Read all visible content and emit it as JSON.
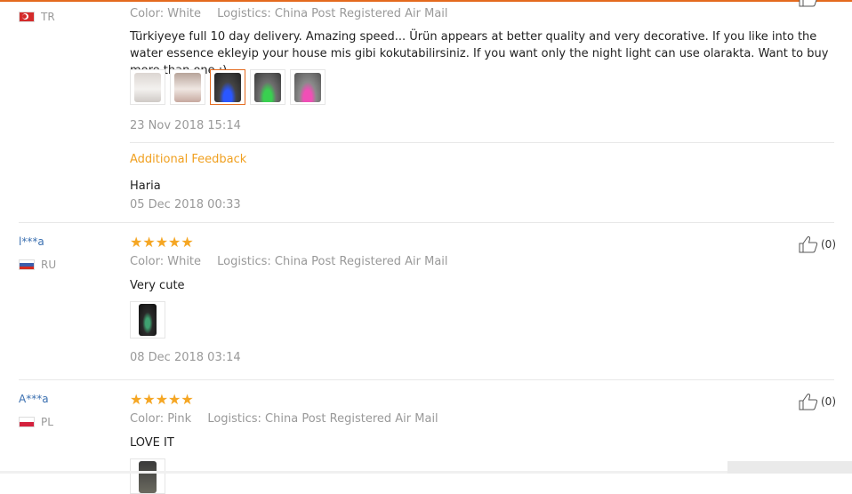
{
  "reviews": [
    {
      "user": "",
      "country": "TR",
      "color": "Color: White",
      "logistics": "Logistics: China Post Registered Air Mail",
      "text": "Türkiyeye full 10 day delivery. Amazing speed... Ürün appears at better quality and very decorative. If you like into the water essence ekleyip your house mis gibi kokutabilirsiniz. If you want only the night light can use olarakta. Want to buy more than one :)",
      "date": "23 Nov 2018 15:14",
      "additional_label": "Additional Feedback",
      "additional_text": "Haria",
      "additional_date": "05 Dec 2018 00:33"
    },
    {
      "user": "l***a",
      "country": "RU",
      "stars": "★★★★★",
      "color": "Color: White",
      "logistics": "Logistics: China Post Registered Air Mail",
      "text": "Very cute",
      "date": "08 Dec 2018 03:14",
      "helpful": "(0)"
    },
    {
      "user": "A***a",
      "country": "PL",
      "stars": "★★★★★",
      "color": "Color: Pink",
      "logistics": "Logistics: China Post Registered Air Mail",
      "text": "LOVE IT",
      "helpful": "(0)"
    }
  ],
  "colors": {
    "accent": "#e46a1e",
    "star": "#f5a623",
    "link": "#3a6fb0",
    "muted": "#999999"
  }
}
